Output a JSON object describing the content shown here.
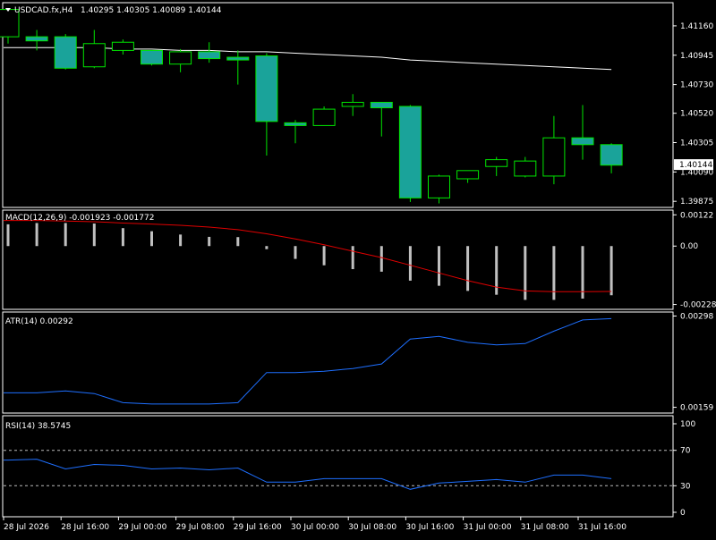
{
  "header": {
    "symbol": "USDCAD.fx,H4",
    "ohlc": "1.40295 1.40305 1.40089 1.40144"
  },
  "indicators": {
    "macd_label": "MACD(12,26,9) -0.001923 -0.001772",
    "atr_label": "ATR(14) 0.00292",
    "rsi_label": "RSI(14) 38.5745"
  },
  "colors": {
    "background": "#000000",
    "grid_frame": "#ffffff",
    "bull_candle": "#000000",
    "bear_candle": "#1aa39a",
    "wick": "#00e600",
    "ma_line": "#ffffff",
    "macd_hist": "#c0c0c0",
    "macd_signal": "#e00000",
    "atr_line": "#1e6fff",
    "rsi_line": "#1e6fff"
  },
  "chart_data": [
    {
      "type": "candlestick",
      "panel": "price",
      "price_axis_ticks": [
        "1.41160",
        "1.40945",
        "1.40730",
        "1.40520",
        "1.40305",
        "1.40090",
        "1.39875"
      ],
      "current_price": "1.40144",
      "ylim": [
        1.3985,
        1.4131
      ],
      "candles": [
        {
          "o": 1.4108,
          "h": 1.4128,
          "l": 1.4103,
          "c": 1.4128
        },
        {
          "o": 1.4108,
          "h": 1.4113,
          "l": 1.4098,
          "c": 1.4105
        },
        {
          "o": 1.4108,
          "h": 1.411,
          "l": 1.4084,
          "c": 1.4085
        },
        {
          "o": 1.4086,
          "h": 1.4113,
          "l": 1.4085,
          "c": 1.4103
        },
        {
          "o": 1.4098,
          "h": 1.4106,
          "l": 1.4095,
          "c": 1.4104
        },
        {
          "o": 1.4098,
          "h": 1.4097,
          "l": 1.4087,
          "c": 1.4088
        },
        {
          "o": 1.4088,
          "h": 1.4099,
          "l": 1.4082,
          "c": 1.4097
        },
        {
          "o": 1.4097,
          "h": 1.4104,
          "l": 1.4089,
          "c": 1.4092
        },
        {
          "o": 1.4093,
          "h": 1.4098,
          "l": 1.4073,
          "c": 1.4091
        },
        {
          "o": 1.4094,
          "h": 1.4096,
          "l": 1.4021,
          "c": 1.4046
        },
        {
          "o": 1.4045,
          "h": 1.4047,
          "l": 1.403,
          "c": 1.4043
        },
        {
          "o": 1.4043,
          "h": 1.4057,
          "l": 1.4043,
          "c": 1.4055
        },
        {
          "o": 1.4057,
          "h": 1.4066,
          "l": 1.405,
          "c": 1.406
        },
        {
          "o": 1.406,
          "h": 1.4058,
          "l": 1.4035,
          "c": 1.4056
        },
        {
          "o": 1.4057,
          "h": 1.4058,
          "l": 1.3987,
          "c": 1.399
        },
        {
          "o": 1.399,
          "h": 1.4007,
          "l": 1.3986,
          "c": 1.4006
        },
        {
          "o": 1.4004,
          "h": 1.401,
          "l": 1.4001,
          "c": 1.401
        },
        {
          "o": 1.4013,
          "h": 1.402,
          "l": 1.4006,
          "c": 1.4018
        },
        {
          "o": 1.4006,
          "h": 1.402,
          "l": 1.4005,
          "c": 1.4017
        },
        {
          "o": 1.4006,
          "h": 1.405,
          "l": 1.4,
          "c": 1.4034
        },
        {
          "o": 1.4034,
          "h": 1.4058,
          "l": 1.4018,
          "c": 1.4029
        },
        {
          "o": 1.4029,
          "h": 1.403,
          "l": 1.4008,
          "c": 1.4014
        }
      ],
      "moving_average": [
        1.41,
        1.41,
        1.41,
        1.41,
        1.4099,
        1.4099,
        1.4098,
        1.4098,
        1.4097,
        1.4097,
        1.4096,
        1.4095,
        1.4094,
        1.4093,
        1.4091,
        1.409,
        1.4089,
        1.4088,
        1.4087,
        1.4086,
        1.4085,
        1.4084
      ]
    },
    {
      "type": "bar",
      "panel": "macd",
      "axis_ticks": [
        "0.00122",
        "0.00",
        "-0.00228"
      ],
      "ylim": [
        -0.0024,
        0.0013
      ],
      "histogram": [
        0.00085,
        0.0009,
        0.0009,
        0.00088,
        0.0007,
        0.00058,
        0.00045,
        0.00036,
        0.00035,
        -0.00012,
        -0.0005,
        -0.00075,
        -0.0009,
        -0.001,
        -0.00135,
        -0.00155,
        -0.00175,
        -0.0019,
        -0.0021,
        -0.0021,
        -0.00205,
        -0.00192
      ],
      "signal": [
        0.001,
        0.001,
        0.00098,
        0.00095,
        0.0009,
        0.00086,
        0.00081,
        0.00074,
        0.00064,
        0.00048,
        0.00028,
        5e-05,
        -0.0002,
        -0.00045,
        -0.00075,
        -0.00105,
        -0.00135,
        -0.0016,
        -0.00175,
        -0.00178,
        -0.00178,
        -0.00177
      ]
    },
    {
      "type": "line",
      "panel": "atr",
      "axis_ticks": [
        "0.00298",
        "0.00159"
      ],
      "ylim": [
        0.00153,
        0.003
      ],
      "values": [
        0.00181,
        0.00181,
        0.00184,
        0.0018,
        0.00166,
        0.00164,
        0.00164,
        0.00164,
        0.00166,
        0.00212,
        0.00212,
        0.00214,
        0.00218,
        0.00225,
        0.00263,
        0.00267,
        0.00258,
        0.00254,
        0.00256,
        0.00275,
        0.00292,
        0.00294
      ]
    },
    {
      "type": "line",
      "panel": "rsi",
      "axis_ticks": [
        "100",
        "70",
        "30",
        "0"
      ],
      "ylim": [
        0,
        100
      ],
      "levels": [
        70,
        30
      ],
      "values": [
        59,
        60,
        49,
        54,
        53,
        49,
        50,
        48,
        50,
        34,
        34,
        38,
        38,
        38,
        26,
        33,
        35,
        37,
        34,
        42,
        42,
        38
      ]
    }
  ],
  "time_axis": [
    "28 Jul 2026",
    "28 Jul 16:00",
    "29 Jul 00:00",
    "29 Jul 08:00",
    "29 Jul 16:00",
    "30 Jul 00:00",
    "30 Jul 08:00",
    "30 Jul 16:00",
    "31 Jul 00:00",
    "31 Jul 08:00",
    "31 Jul 16:00"
  ]
}
